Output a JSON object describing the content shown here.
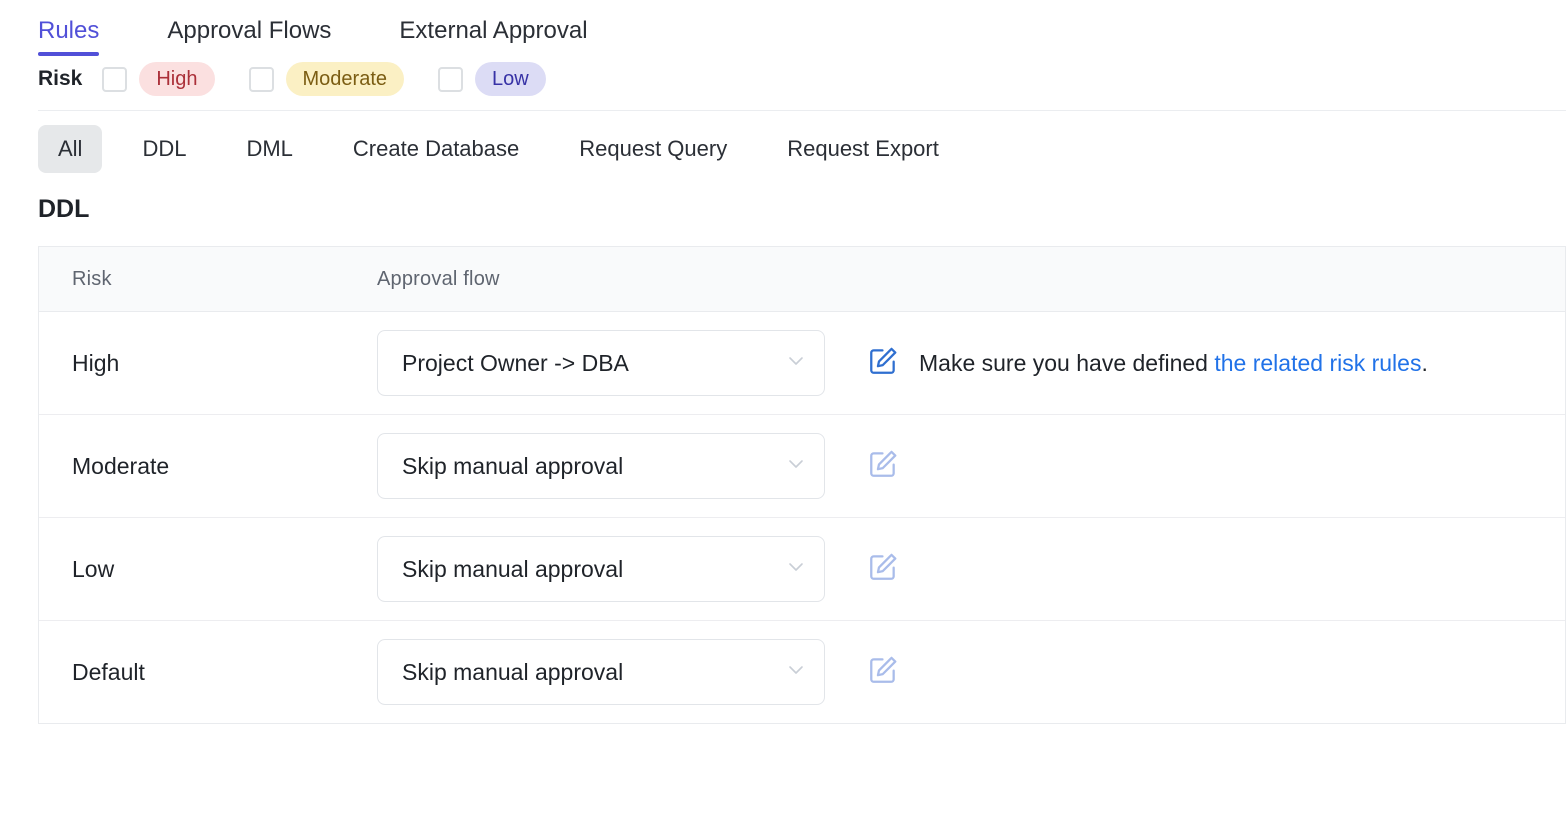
{
  "tabs": [
    {
      "label": "Rules",
      "active": true
    },
    {
      "label": "Approval Flows",
      "active": false
    },
    {
      "label": "External Approval",
      "active": false
    }
  ],
  "risk_filter": {
    "label": "Risk",
    "options": [
      {
        "label": "High",
        "checked": false,
        "bg": "#fbe0e0",
        "fg": "#ab3039"
      },
      {
        "label": "Moderate",
        "checked": false,
        "bg": "#fbf0c4",
        "fg": "#7b5d13"
      },
      {
        "label": "Low",
        "checked": false,
        "bg": "#dcdcf5",
        "fg": "#3732a6"
      }
    ]
  },
  "type_tabs": [
    {
      "label": "All",
      "active": true
    },
    {
      "label": "DDL",
      "active": false
    },
    {
      "label": "DML",
      "active": false
    },
    {
      "label": "Create Database",
      "active": false
    },
    {
      "label": "Request Query",
      "active": false
    },
    {
      "label": "Request Export",
      "active": false
    }
  ],
  "section": {
    "title": "DDL",
    "columns": {
      "risk": "Risk",
      "flow": "Approval flow"
    },
    "rows": [
      {
        "risk": "High",
        "flow": "Project Owner -> DBA",
        "edit_icon": "edit-pencil-square-icon",
        "edit_color": "#2f6fd0",
        "hint_text": "Make sure you have defined ",
        "hint_link": "the related risk rules",
        "hint_suffix": "."
      },
      {
        "risk": "Moderate",
        "flow": "Skip manual approval",
        "edit_icon": "edit-pencil-square-icon",
        "edit_color": "#a9bcea",
        "hint_text": "",
        "hint_link": "",
        "hint_suffix": ""
      },
      {
        "risk": "Low",
        "flow": "Skip manual approval",
        "edit_icon": "edit-pencil-square-icon",
        "edit_color": "#a9bcea",
        "hint_text": "",
        "hint_link": "",
        "hint_suffix": ""
      },
      {
        "risk": "Default",
        "flow": "Skip manual approval",
        "edit_icon": "edit-pencil-square-icon",
        "edit_color": "#a9bcea",
        "hint_text": "",
        "hint_link": "",
        "hint_suffix": ""
      }
    ]
  },
  "colors": {
    "accent": "#5150d8",
    "link": "#2172e8",
    "chip_active_bg": "#e6e8ea",
    "table_header_bg": "#f9fafb",
    "border": "#e9ebee"
  }
}
